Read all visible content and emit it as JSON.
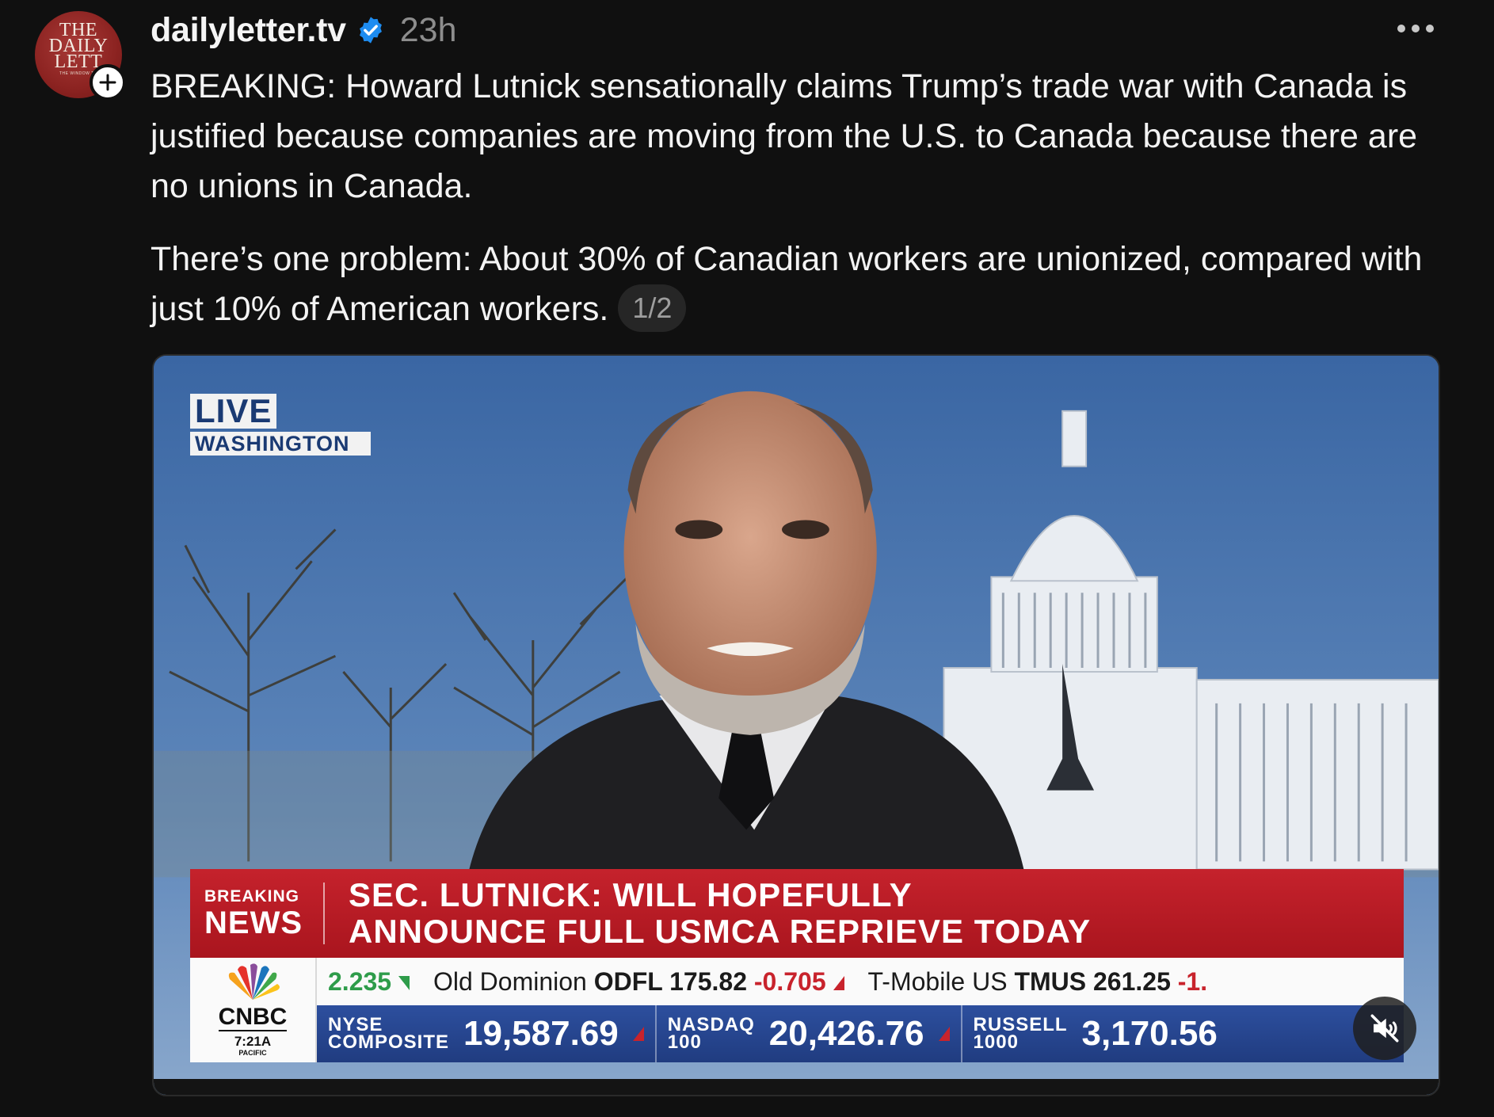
{
  "post": {
    "avatar": {
      "logo_lines": [
        "THE",
        "DAILY",
        "LETT"
      ],
      "logo_tagline": "THE WINDOW TO"
    },
    "username": "dailyletter.tv",
    "verified_icon": "verified-badge-icon",
    "timestamp": "23h",
    "paragraph1": "BREAKING: Howard Lutnick sensationally claims Trump’s trade war with Canada is justified because companies are moving from the U.S. to Canada because there are no unions in Canada.",
    "paragraph2": "There’s one problem: About 30% of Canadian workers are unionized, compared with just 10% of American workers.",
    "page_indicator": "1/2"
  },
  "video": {
    "live_label": "LIVE",
    "location": "WASHINGTON",
    "breaking_small": "BREAKING",
    "breaking_big": "NEWS",
    "headline_line1": "SEC. LUTNICK: WILL HOPEFULLY",
    "headline_line2": "ANNOUNCE FULL USMCA REPRIEVE TODAY",
    "network": "CNBC",
    "clock": "7:21A",
    "clock_zone": "PACIFIC",
    "ticker_top": {
      "item0_value": "2.235",
      "item1_name": "Old Dominion",
      "item1_symbol": "ODFL 175.82",
      "item1_change": "-0.705",
      "item2_name": "T-Mobile US",
      "item2_symbol": "TMUS 261.25",
      "item2_change": "-1."
    },
    "indices": [
      {
        "name_line1": "NYSE",
        "name_line2": "COMPOSITE",
        "value": "19,587.69"
      },
      {
        "name_line1": "NASDAQ",
        "name_line2": "100",
        "value": "20,426.76"
      },
      {
        "name_line1": "RUSSELL",
        "name_line2": "1000",
        "value": "3,170.56"
      }
    ],
    "colors": {
      "red_bar": "#c5222c",
      "blue_bar": "#2d4f9e",
      "up": "#2e9c4a",
      "down": "#c8232c"
    }
  }
}
